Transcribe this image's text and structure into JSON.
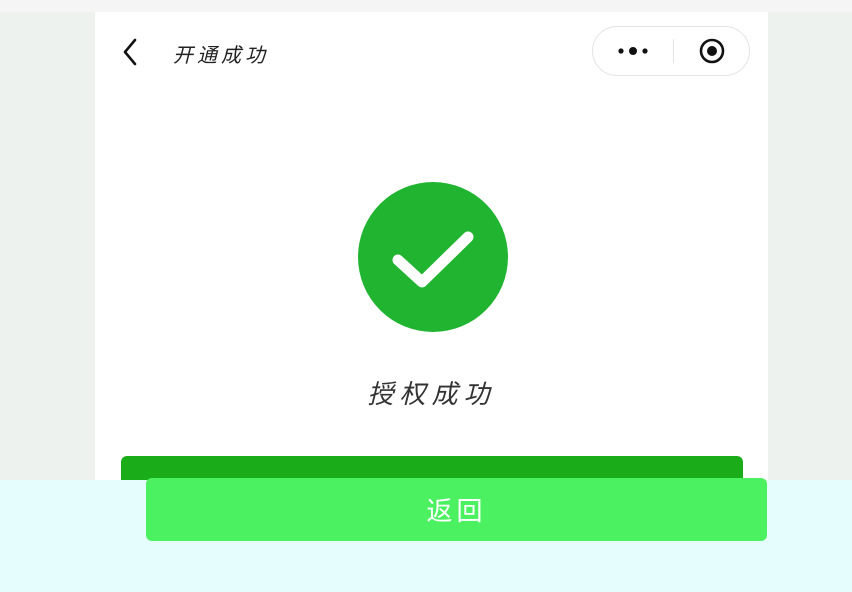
{
  "header": {
    "title": "开通成功",
    "back_icon": "chevron-left-icon",
    "more_icon": "more-dots-icon",
    "close_icon": "target-close-icon"
  },
  "main": {
    "status_icon": "check-circle-icon",
    "status_text": "授权成功"
  },
  "footer": {
    "button_label": "返回"
  },
  "colors": {
    "success_green": "#21b431",
    "button_green": "#4cf162",
    "button_dark_green": "#1aad19"
  }
}
